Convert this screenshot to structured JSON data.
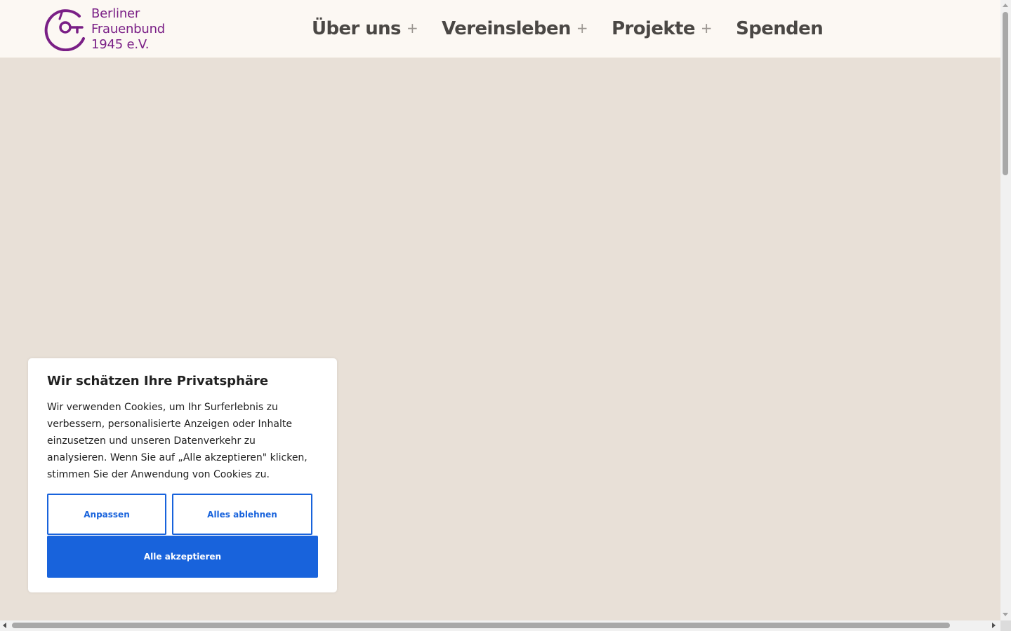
{
  "colors": {
    "brand_purple": "#7a1f86",
    "header_bg": "#fcf8f3",
    "page_bg": "#e8e0d7",
    "nav_text": "#4a4744",
    "cookie_blue": "#1863dc"
  },
  "logo": {
    "icon": "frauenbund-logo-icon",
    "line1": "Berliner",
    "line2": "Frauenbund",
    "line3": "1945 e.V."
  },
  "nav": {
    "items": [
      {
        "label": "Über uns",
        "expandable": true,
        "indicator": "+"
      },
      {
        "label": "Vereinsleben",
        "expandable": true,
        "indicator": "+"
      },
      {
        "label": "Projekte",
        "expandable": true,
        "indicator": "+"
      },
      {
        "label": "Spenden",
        "expandable": false
      }
    ]
  },
  "cookie": {
    "title": "Wir schätzen Ihre Privatsphäre",
    "text": "Wir verwenden Cookies, um Ihr Surferlebnis zu verbessern, personalisierte Anzeigen oder Inhalte einzusetzen und unseren Datenverkehr zu analysieren. Wenn Sie auf „Alle akzeptieren\" klicken, stimmen Sie der Anwendung von Cookies zu.",
    "customize_label": "Anpassen",
    "reject_label": "Alles ablehnen",
    "accept_label": "Alle akzeptieren"
  }
}
